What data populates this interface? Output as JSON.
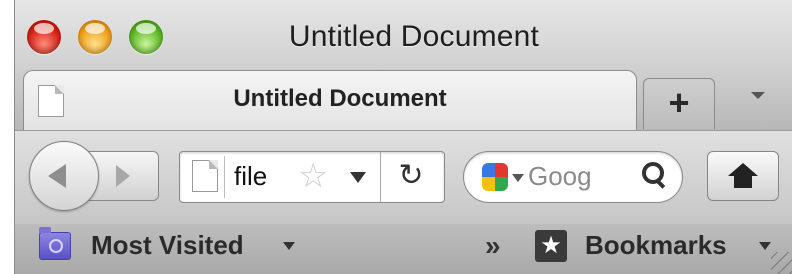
{
  "window": {
    "title": "Untitled Document",
    "controls": [
      "close",
      "minimize",
      "zoom"
    ]
  },
  "tabs": {
    "active": {
      "label": "Untitled Document",
      "icon": "document-icon"
    },
    "new_tab_label": "+",
    "list_icon": "chevron-down-icon"
  },
  "toolbar": {
    "back_icon": "back-arrow-icon",
    "forward_icon": "forward-arrow-icon",
    "url": {
      "icon": "document-icon",
      "value": "file",
      "star_glyph": "☆",
      "reload_glyph": "↻"
    },
    "search": {
      "engine_icon": "google-icon",
      "placeholder": "Goog",
      "icon": "magnifier-icon"
    },
    "home_icon": "home-icon"
  },
  "bookmarks_bar": {
    "most_visited": {
      "label": "Most Visited",
      "icon": "folder-icon"
    },
    "overflow_glyph": "»",
    "bookmarks": {
      "label": "Bookmarks",
      "icon": "bookmark-star-icon",
      "glyph": "★"
    }
  },
  "colors": {
    "close": "#d21e12",
    "minimize": "#f09a13",
    "zoom": "#56b31d",
    "folder": "#5a50c7"
  }
}
